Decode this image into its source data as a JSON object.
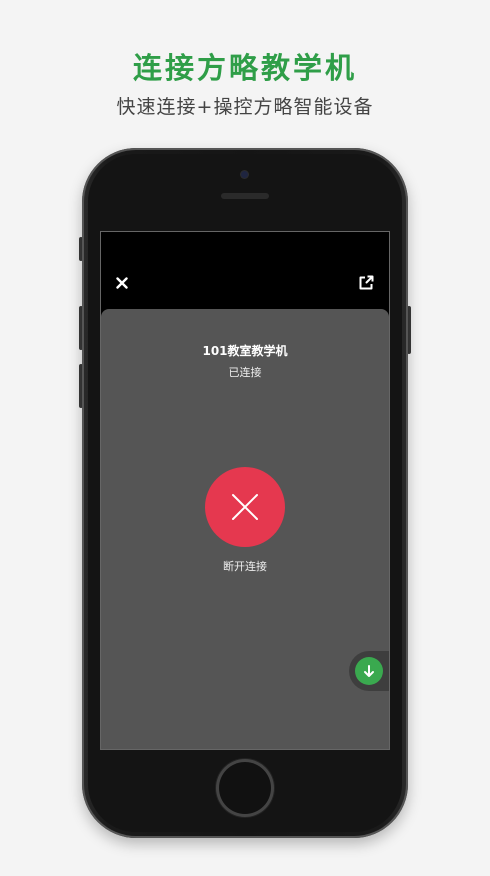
{
  "promo": {
    "title": "连接方略教学机",
    "subtitle": "快速连接+操控方略智能设备"
  },
  "screen": {
    "close_icon": "close-icon",
    "external_icon": "external-link-icon",
    "device": {
      "name": "101教室教学机",
      "status": "已连接"
    },
    "disconnect": {
      "label": "断开连接",
      "icon": "x-icon",
      "color": "#e5384f"
    },
    "floating_action": {
      "icon": "arrow-down-icon",
      "color": "#3aa94f"
    }
  },
  "colors": {
    "accent": "#2f9e48",
    "panel": "#555555",
    "background": "#f4f4f4"
  }
}
